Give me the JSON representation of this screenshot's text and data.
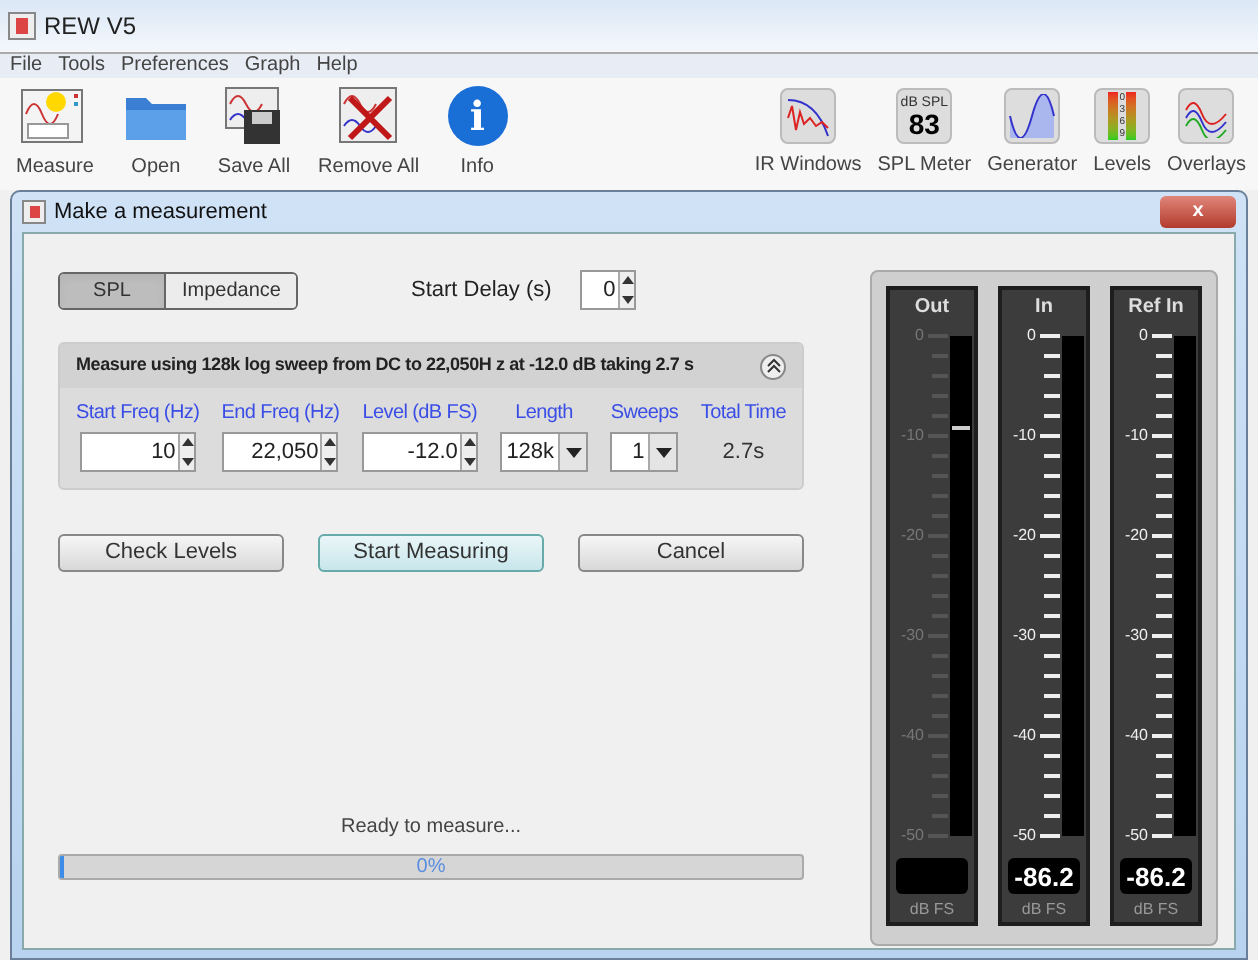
{
  "window": {
    "title": "REW V5"
  },
  "menu": [
    "File",
    "Tools",
    "Preferences",
    "Graph",
    "Help"
  ],
  "toolbar": [
    {
      "label": "Measure"
    },
    {
      "label": "Open"
    },
    {
      "label": "Save All"
    },
    {
      "label": "Remove All"
    },
    {
      "label": "Info",
      "icon_text": [
        "i"
      ]
    },
    {
      "label": "IR Windows"
    },
    {
      "label": "SPL Meter",
      "icon_text": [
        "dB SPL",
        "83"
      ]
    },
    {
      "label": "Generator"
    },
    {
      "label": "Levels",
      "icon_text": [
        "0",
        "3",
        "6",
        "9"
      ]
    },
    {
      "label": "Overlays"
    }
  ],
  "dialog": {
    "title": "Make a measurement",
    "close": "x",
    "mode_tabs": [
      {
        "label": "SPL",
        "selected": true
      },
      {
        "label": "Impedance",
        "selected": false
      }
    ],
    "start_delay": {
      "label": "Start Delay (s)",
      "value": "0"
    },
    "sweep": {
      "summary": "Measure using  128k log sweep from DC to 22,050H z at -12.0 dB taking 2.7 s",
      "fields": [
        {
          "label": "Start Freq (Hz)",
          "value": "10",
          "kind": "spinner"
        },
        {
          "label": "End Freq (Hz)",
          "value": "22,050",
          "kind": "spinner"
        },
        {
          "label": "Level (dB FS)",
          "value": "-12.0",
          "kind": "spinner"
        },
        {
          "label": "Length",
          "value": "128k",
          "kind": "dropdown"
        },
        {
          "label": "Sweeps",
          "value": "1",
          "kind": "dropdown"
        },
        {
          "label": "Total Time",
          "value": "2.7s",
          "kind": "text"
        }
      ]
    },
    "buttons": [
      {
        "label": "Check Levels",
        "selected": false
      },
      {
        "label": "Start Measuring",
        "selected": true
      },
      {
        "label": "Cancel",
        "selected": false
      }
    ],
    "status": "Ready to measure...",
    "progress": {
      "level": 0,
      "text": "0%"
    },
    "meters": [
      {
        "title": "Out",
        "scale": [
          "0",
          "-10",
          "-20",
          "-30",
          "-40",
          "-50"
        ],
        "active": false,
        "level": 0.82,
        "unit": "dB FS"
      },
      {
        "title": "In",
        "scale": [
          "0",
          "-10",
          "-20",
          "-30",
          "-40",
          "-50"
        ],
        "active": true,
        "reading": "-86.2",
        "unit": "dB FS"
      },
      {
        "title": "Ref In",
        "scale": [
          "0",
          "-10",
          "-20",
          "-30",
          "-40",
          "-50"
        ],
        "active": true,
        "reading": "-86.2",
        "unit": "dB FS"
      }
    ]
  }
}
